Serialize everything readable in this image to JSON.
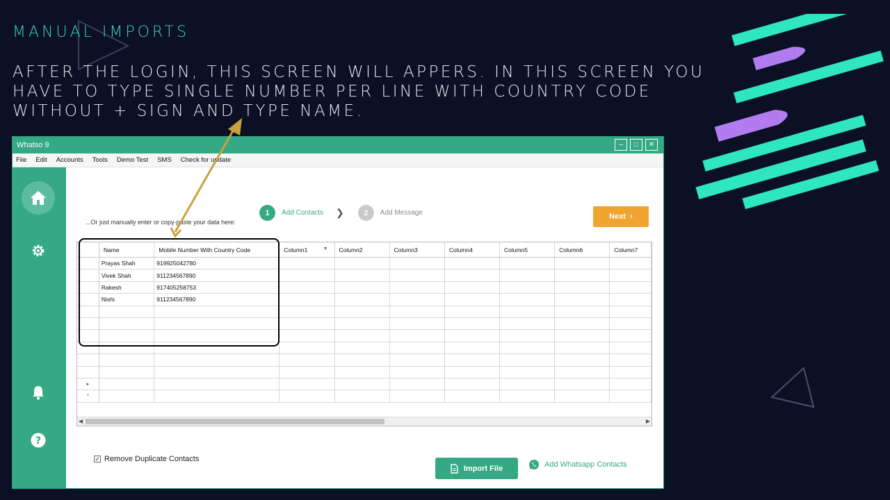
{
  "slide": {
    "heading": "MANUAL IMPORTS",
    "description": "AFTER THE LOGIN, THIS SCREEN WILL APPERS. IN THIS SCREEN YOU HAVE TO TYPE SINGLE NUMBER PER LINE WITH COUNTRY CODE WITHOUT + SIGN AND TYPE NAME."
  },
  "colors": {
    "background": "#0b1024",
    "heading": "#3fd3bf",
    "app_green": "#34a984",
    "next_orange": "#f0a531",
    "ribbon_teal": "#2ee6c0",
    "ribbon_purple": "#b07cf0",
    "arrow_gold": "#c9a23c"
  },
  "window": {
    "title": "Whatso 9",
    "controls": [
      "minimize-icon",
      "maximize-icon",
      "close-icon"
    ]
  },
  "menu": [
    "File",
    "Edit",
    "Accounts",
    "Tools",
    "Demo Test",
    "SMS",
    "Check for update"
  ],
  "sidebar": {
    "top": [
      "home-icon",
      "gear-icon"
    ],
    "bottom": [
      "bell-icon",
      "help-icon"
    ]
  },
  "main": {
    "hint": "...Or just manually enter or copy-paste your data here:",
    "steps": [
      {
        "number": "1",
        "label": "Add Contacts",
        "active": true
      },
      {
        "number": "2",
        "label": "Add Message",
        "active": false
      }
    ],
    "next_label": "Next",
    "columns": [
      "Name",
      "Mobile Number With Country Code",
      "Column1",
      "Column2",
      "Column3",
      "Column4",
      "Column5",
      "Column6",
      "Column7"
    ],
    "rows": [
      [
        "Prayas Shah",
        "919925042780"
      ],
      [
        "Vivek Shah",
        "911234567890"
      ],
      [
        "Rakesh",
        "917405258753"
      ],
      [
        "Nishi",
        "911234567890"
      ]
    ],
    "remove_duplicates_label": "Remove Duplicate Contacts",
    "remove_duplicates_checked": true,
    "import_label": "Import File",
    "add_whatsapp_label": "Add Whatsapp Contacts"
  }
}
